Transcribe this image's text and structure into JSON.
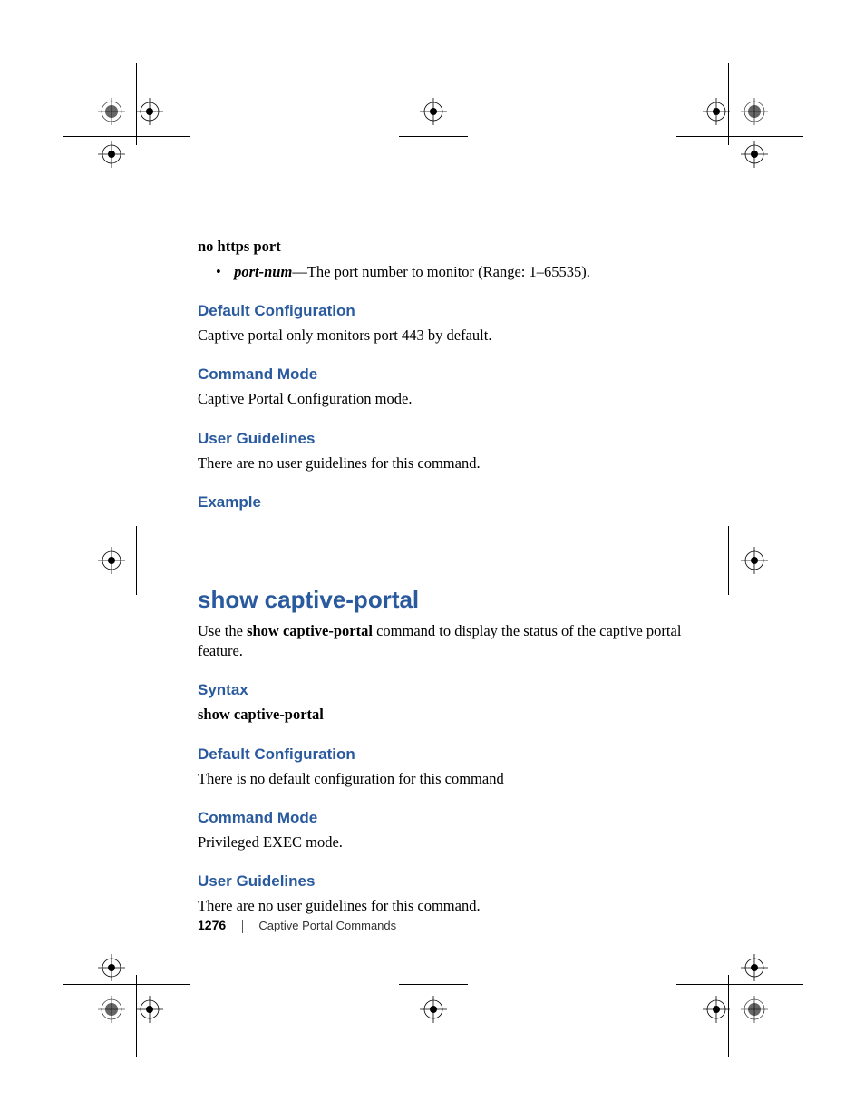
{
  "cmd1": {
    "syntax_line": "no https port",
    "bullet_param": "port-num",
    "bullet_desc": "—The port number to monitor (Range: 1–65535).",
    "default_config_heading": "Default Configuration",
    "default_config_text": "Captive portal only monitors port 443 by default.",
    "command_mode_heading": "Command Mode",
    "command_mode_text": "Captive Portal Configuration mode.",
    "user_guidelines_heading": "User Guidelines",
    "user_guidelines_text": "There are no user guidelines for this command.",
    "example_heading": "Example"
  },
  "cmd2": {
    "title": "show captive-portal",
    "intro_pre": "Use the ",
    "intro_bold": "show captive-portal",
    "intro_post": " command to display the status of the captive portal feature.",
    "syntax_heading": "Syntax",
    "syntax_text": "show captive-portal",
    "default_config_heading": "Default Configuration",
    "default_config_text": "There is no default configuration for this command",
    "command_mode_heading": "Command Mode",
    "command_mode_text": "Privileged EXEC mode.",
    "user_guidelines_heading": "User Guidelines",
    "user_guidelines_text": "There are no user guidelines for this command."
  },
  "footer": {
    "page_number": "1276",
    "chapter": "Captive Portal Commands"
  }
}
